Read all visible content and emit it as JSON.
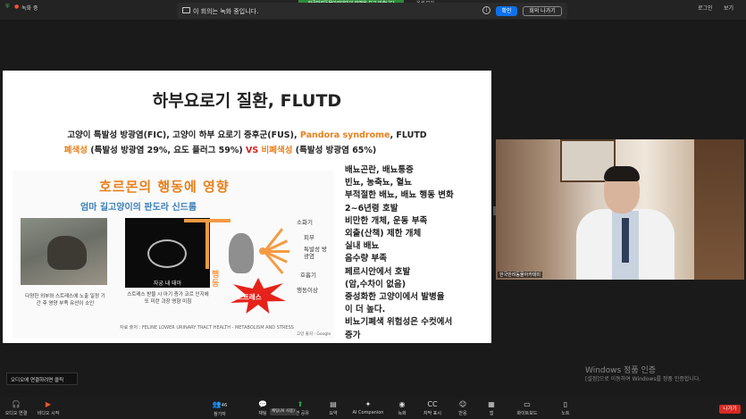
{
  "topbar": {
    "status_left": "녹화 중",
    "status_left_detail": "",
    "green_banner": "한국반려동물아카데미의 화면을 보고 있습니다",
    "view_label": "옵션 보기",
    "recording_notice": "이 회의는 녹화 중입니다.",
    "ok_label": "확인",
    "leave_label": "회의 나가기",
    "login_label": "로그인",
    "view2_label": "보기"
  },
  "slide": {
    "title": "하부요로기 질환, FLUTD",
    "line1_a": "고양이 특발성 방광염(FIC), 고양이 하부 요로기 증후군(FUS), ",
    "line1_highlight": "Pandora syndrome",
    "line1_b": ", FLUTD",
    "line2_a": "폐색성",
    "line2_b": " (특발성 방광염 29%, 요도 플러그 59%) ",
    "line2_vs": "VS",
    "line2_c": " 비폐색성",
    "line2_d": " (특발성 방광염 65%)",
    "panel": {
      "title": "호르몬의 행동에 영향",
      "subtitle": "엄마 길고양이의 판도라 신드롬",
      "ultrasound_label": "자궁 내 태아",
      "behaviors": [
        "소화기",
        "피부",
        "특발성 방광염",
        "호흡기",
        "행동이상"
      ],
      "behavior_word": "행동",
      "stress_label": "스트레스",
      "caption_left": "다양한 외부와 스트레스에 노출 일정 기간 후 영양 부족 유산이 소인",
      "caption_mid": "스트레스 받을 시 아기 증가 코르 인지에 또 미란 괴장 영향 미침",
      "source_line": "자료 출처 : FELINE LOWER URINARY TRACT HEALTH - METABOLISM AND STRESS",
      "copyright": "고양 출처 : Google"
    },
    "symptoms": [
      "배뇨곤란, 배뇨통증",
      "빈뇨, 농축뇨, 혈뇨",
      "부적절한 배뇨, 배뇨 행동 변화",
      "2~6년령 호발",
      "비만한 개체, 운동 부족",
      "외출(산책) 제한 개체",
      "실내 배뇨",
      "음수량 부족",
      "페르시안에서 호발",
      "(암,수차이 없음)",
      "중성화한 고양이에서 발병율",
      "이 더 높다.",
      "비뇨기폐색 위험성은 수컷에서",
      "증가"
    ]
  },
  "video": {
    "name_tag": "한국반려동물아카데미"
  },
  "watermark": {
    "title": "Windows 정품 인증",
    "subtitle": "[설정]으로 이동하여 Windows를 정품 인증합니다."
  },
  "tooltip": "오디오에 연결하려면 클릭",
  "toolbar": {
    "audio": "오디오 연결",
    "video": "비디오 시작",
    "participants": "참가자",
    "participants_count": "46",
    "chat": "채팅",
    "share": "화면 공유",
    "summary": "요약",
    "ai": "AI Companion",
    "record": "녹화",
    "caption": "자막 표시",
    "reactions": "반응",
    "apps": "앱",
    "whiteboard": "화이트보드",
    "notes": "노트",
    "exit": "나가기",
    "chat_popup": "채팅(AI 사용)"
  },
  "colors": {
    "accent_blue": "#0e71eb",
    "recording_green": "#2e8b3a",
    "exit_red": "#d62a23",
    "highlight_orange": "#e8801c"
  }
}
